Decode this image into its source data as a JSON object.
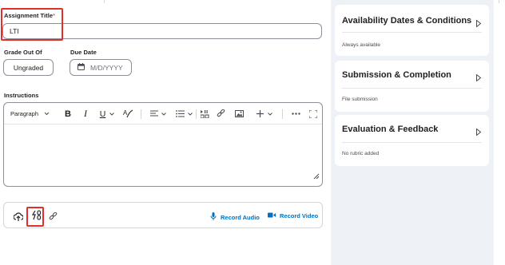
{
  "form": {
    "title_label": "Assignment Title",
    "required_mark": "*",
    "title_value": "LTI",
    "grade_label": "Grade Out Of",
    "grade_value": "Ungraded",
    "due_label": "Due Date",
    "due_placeholder": "M/D/YYYY",
    "instructions_label": "Instructions"
  },
  "editor_toolbar": {
    "paragraph_select": "Paragraph",
    "items": [
      "bold-icon",
      "italic-icon",
      "underline-icon",
      "text-style-icon",
      "align-icon",
      "list-icon",
      "insert-stuff-icon",
      "link-icon",
      "image-icon",
      "insert-icon",
      "more-icon",
      "fullscreen-icon"
    ]
  },
  "attachments": {
    "record_audio": "Record Audio",
    "record_video": "Record Video",
    "icons": [
      "upload-icon",
      "quicklink-icon",
      "link-icon",
      "microphone-icon",
      "video-camera-icon"
    ]
  },
  "sidebar": {
    "cards": [
      {
        "title": "Availability Dates & Conditions",
        "subtitle": "Always available"
      },
      {
        "title": "Submission & Completion",
        "subtitle": "File submission"
      },
      {
        "title": "Evaluation & Feedback",
        "subtitle": "No rubric added"
      }
    ]
  },
  "colors": {
    "highlight": "#e0302b",
    "link": "#006fbf",
    "sidebar_bg": "#eef1f5",
    "border": "#8d9096"
  }
}
